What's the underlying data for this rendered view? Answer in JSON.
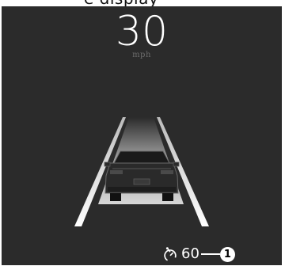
{
  "header": {
    "partial_text": "e display"
  },
  "speed": {
    "value": "30",
    "unit": "mph"
  },
  "set_speed": {
    "icon": "cruise-control-icon",
    "value": "60"
  },
  "callout": {
    "number": "1"
  },
  "colors": {
    "background": "#2b2b2b",
    "text": "#ffffff",
    "unit_text": "#6d6d6d",
    "lane_highlight": "#bdbdbd"
  }
}
